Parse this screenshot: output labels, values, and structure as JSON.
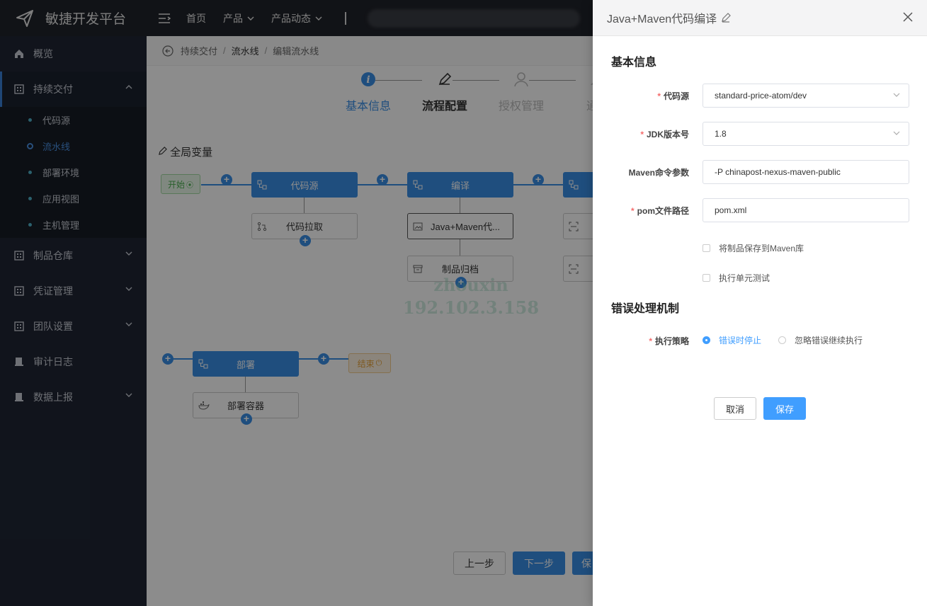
{
  "app": {
    "title": "敏捷开发平台"
  },
  "topnav": {
    "home": "首页",
    "product": "产品",
    "news": "产品动态"
  },
  "sidebar": {
    "items": [
      {
        "label": "概览"
      },
      {
        "label": "持续交付"
      },
      {
        "label": "制品仓库"
      },
      {
        "label": "凭证管理"
      },
      {
        "label": "团队设置"
      },
      {
        "label": "审计日志"
      },
      {
        "label": "数据上报"
      }
    ],
    "sub_items": [
      {
        "label": "代码源"
      },
      {
        "label": "流水线"
      },
      {
        "label": "部署环境"
      },
      {
        "label": "应用视图"
      },
      {
        "label": "主机管理"
      }
    ]
  },
  "breadcrumb": {
    "level1": "持续交付",
    "level2": "流水线",
    "level3": "编辑流水线"
  },
  "steps": {
    "s1": "基本信息",
    "s2": "流程配置",
    "s3": "授权管理",
    "s4": "通知"
  },
  "pipeline": {
    "global_vars": "全局变量",
    "start": "开始",
    "end": "结束",
    "stage1": "代码源",
    "stage2": "编译",
    "stage3": "部署",
    "task_pull": "代码拉取",
    "task_build": "Java+Maven代...",
    "task_archive": "制品归档",
    "task_deploy": "部署容器"
  },
  "watermark": {
    "line1": "zhouxin",
    "line2": "192.102.3.158"
  },
  "bottom_buttons": {
    "prev": "上一步",
    "next": "下一步",
    "save": "保"
  },
  "drawer": {
    "title": "Java+Maven代码编译",
    "section1": "基本信息",
    "section2": "错误处理机制",
    "fields": {
      "code_source": {
        "label": "代码源",
        "value": "standard-price-atom/dev"
      },
      "jdk": {
        "label": "JDK版本号",
        "value": "1.8"
      },
      "maven_args": {
        "label": "Maven命令参数",
        "value": "-P chinapost-nexus-maven-public"
      },
      "pom": {
        "label": "pom文件路径",
        "value": "pom.xml"
      }
    },
    "checkbox_save_maven": "将制品保存到Maven库",
    "checkbox_unit_test": "执行单元测试",
    "strategy_label": "执行策略",
    "strategy_opt1": "错误时停止",
    "strategy_opt2": "忽略错误继续执行",
    "cancel": "取消",
    "save": "保存"
  },
  "colors": {
    "primary": "#3a8ee6",
    "sidebar_bg": "#1f2634",
    "topbar_bg": "#20232a",
    "required": "#f56c6c"
  }
}
